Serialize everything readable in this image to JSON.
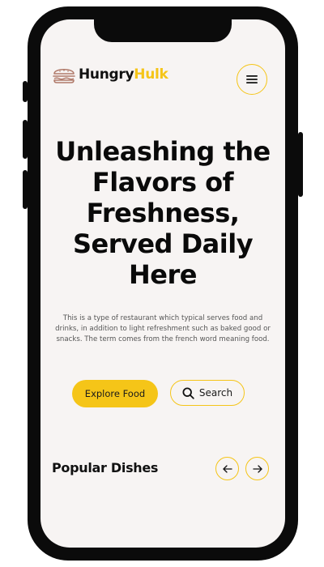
{
  "header": {
    "brand_primary": "Hungry",
    "brand_accent": "Hulk",
    "logo_icon": "burger-icon",
    "menu_icon": "hamburger-menu-icon"
  },
  "hero": {
    "title_lines": [
      "Unleashing the",
      "Flavors of",
      "Freshness,",
      "Served Daily",
      "Here"
    ],
    "description": "This is a type of restaurant which typical serves food and drinks, in addition to light refreshment such as baked good or snacks. The term comes from the french word meaning food.",
    "explore_label": "Explore Food",
    "search_label": "Search",
    "search_icon": "search-icon"
  },
  "popular": {
    "title": "Popular Dishes",
    "prev_icon": "arrow-left-icon",
    "next_icon": "arrow-right-icon"
  },
  "colors": {
    "accent": "#f5c518",
    "background": "#f7f4f3",
    "text": "#111111",
    "device_frame": "#0b0b0b"
  }
}
